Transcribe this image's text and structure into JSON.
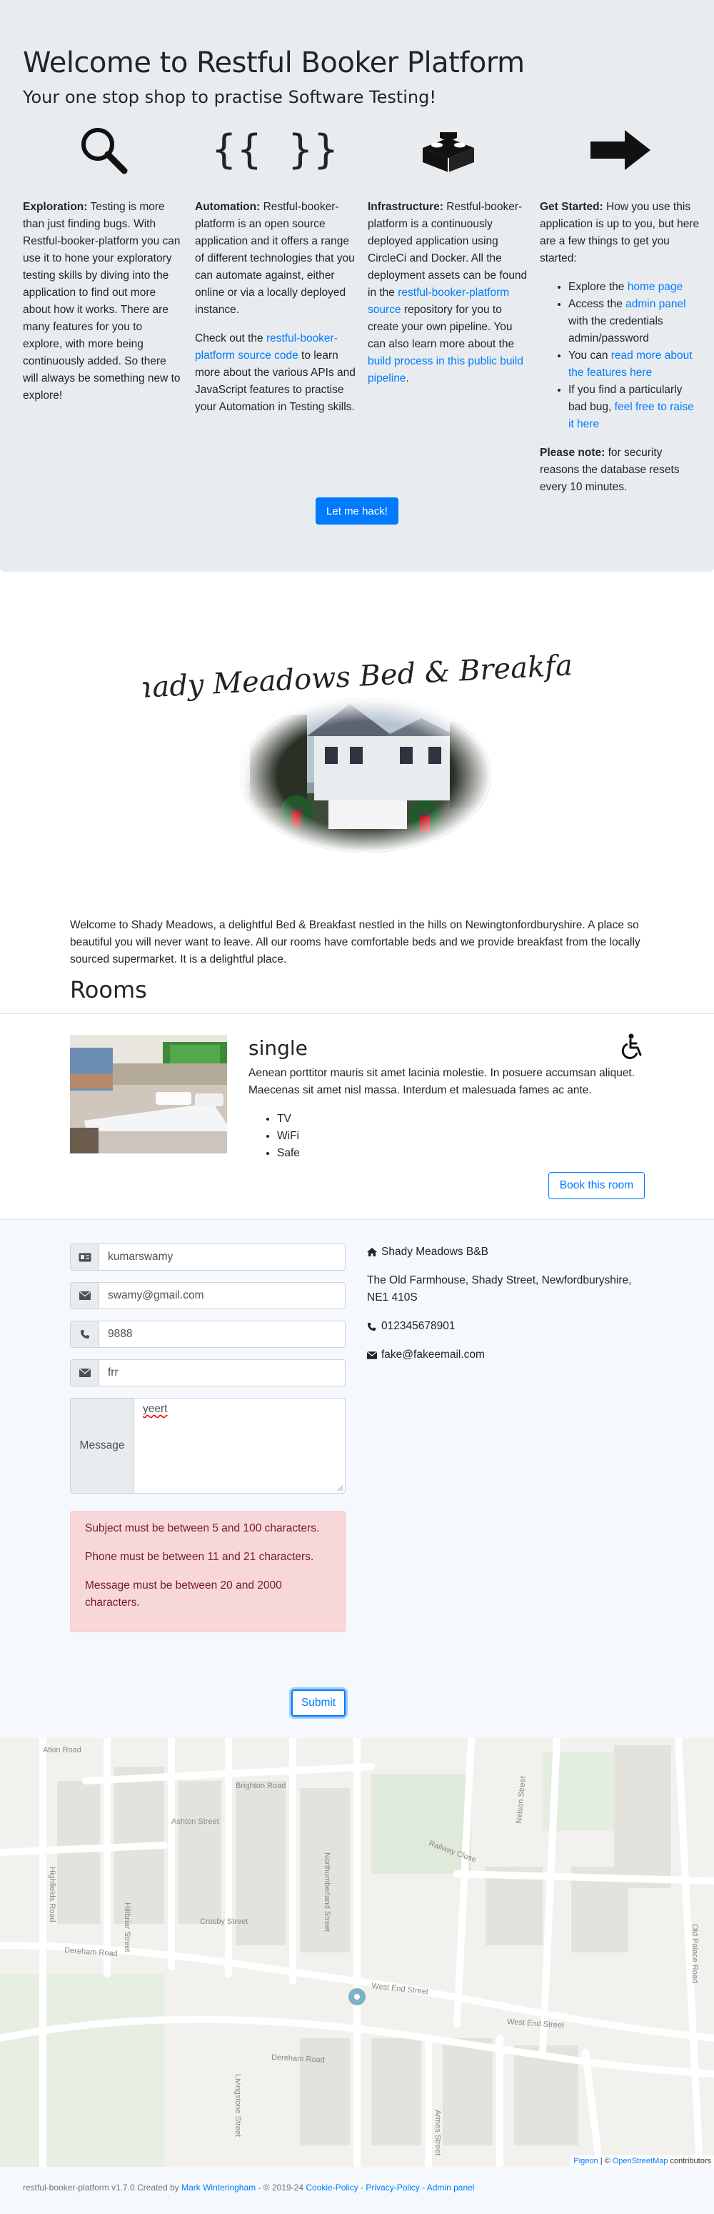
{
  "hero": {
    "title": "Welcome to Restful Booker Platform",
    "subtitle": "Your one stop shop to practise Software Testing!",
    "button": "Let me hack!",
    "col1": {
      "icon": "magnifier-icon",
      "bold": "Exploration:",
      "text": " Testing is more than just finding bugs. With Restful-booker-platform you can use it to hone your exploratory testing skills by diving into the application to find out more about how it works. There are many features for you to explore, with more being continuously added. So there will always be something new to explore!"
    },
    "col2": {
      "icon": "braces-icon",
      "braces": "{{ }}",
      "bold": "Automation:",
      "text": " Restful-booker-platform is an open source application and it offers a range of different technologies that you can automate against, either online or via a locally deployed instance.",
      "p2_before": "Check out the ",
      "p2_link": "restful-booker-platform source code",
      "p2_after": " to learn more about the various APIs and JavaScript features to practise your Automation in Testing skills."
    },
    "col3": {
      "icon": "lego-brick-icon",
      "bold": "Infrastructure:",
      "text": " Restful-booker-platform is a continuously deployed application using CircleCi and Docker. All the deployment assets can be found in the ",
      "link1": "restful-booker-platform source",
      "mid": " repository for you to create your own pipeline. You can also learn more about the ",
      "link2": "build process in this public build pipeline",
      "end": "."
    },
    "col4": {
      "icon": "arrow-right-icon",
      "bold": "Get Started:",
      "text": " How you use this application is up to you, but here are a few things to get you started:",
      "li1_before": "Explore the ",
      "li1_link": "home page",
      "li2_before": "Access the ",
      "li2_link": "admin panel",
      "li2_after": " with the credentials admin/password",
      "li3_before": "You can ",
      "li3_link": "read more about the features here",
      "li4_before": "If you find a particularly bad bug, ",
      "li4_link": "feel free to raise it here",
      "note_bold": "Please note:",
      "note_text": " for security reasons the database resets every 10 minutes."
    }
  },
  "hotel": {
    "logo_text": "Shady Meadows Bed & Breakfast",
    "description": "Welcome to Shady Meadows, a delightful Bed & Breakfast nestled in the hills on Newingtonfordburyshire. A place so beautiful you will never want to leave. All our rooms have comfortable beds and we provide breakfast from the locally sourced supermarket. It is a delightful place."
  },
  "rooms": {
    "heading": "Rooms",
    "items": [
      {
        "name": "single",
        "description": "Aenean porttitor mauris sit amet lacinia molestie. In posuere accumsan aliquet. Maecenas sit amet nisl massa. Interdum et malesuada fames ac ante.",
        "features": [
          "TV",
          "WiFi",
          "Safe"
        ],
        "book_label": "Book this room"
      }
    ]
  },
  "contact": {
    "name_value": "kumarswamy",
    "email_value": "swamy@gmail.com",
    "phone_value": "9888",
    "subject_value": "frr",
    "message_label": "Message",
    "message_value": "yeert",
    "errors": [
      "Subject must be between 5 and 100 characters.",
      "Phone must be between 11 and 21 characters.",
      "Message must be between 20 and 2000 characters."
    ],
    "submit": "Submit",
    "business_name": "Shady Meadows B&B",
    "address": "The Old Farmhouse, Shady Street, Newfordburyshire, NE1 410S",
    "phone": "012345678901",
    "email": "fake@fakeemail.com"
  },
  "map": {
    "streets": [
      "Atkin Road",
      "Brighton Road",
      "Ashton Street",
      "Hillbriar Street",
      "Highfields Road",
      "Crosby Street",
      "Dereham Road",
      "West End Street",
      "Dereham Road",
      "West End Street",
      "Railway Close",
      "Old Palace Road",
      "Nelson Street",
      "Armes Street",
      "Livingstone Street",
      "Northumberland Street"
    ],
    "attribution_link1": "Pigeon",
    "attribution_sep": " | © ",
    "attribution_link2": "OpenStreetMap",
    "attribution_after": " contributors"
  },
  "footer": {
    "text": "restful-booker-platform v1.7.0 Created by ",
    "author": "Mark Winteringham",
    "copyright": " - © 2019-24 ",
    "cookie": "Cookie-Policy",
    "sep": " - ",
    "privacy": "Privacy-Policy",
    "admin": "Admin panel"
  }
}
